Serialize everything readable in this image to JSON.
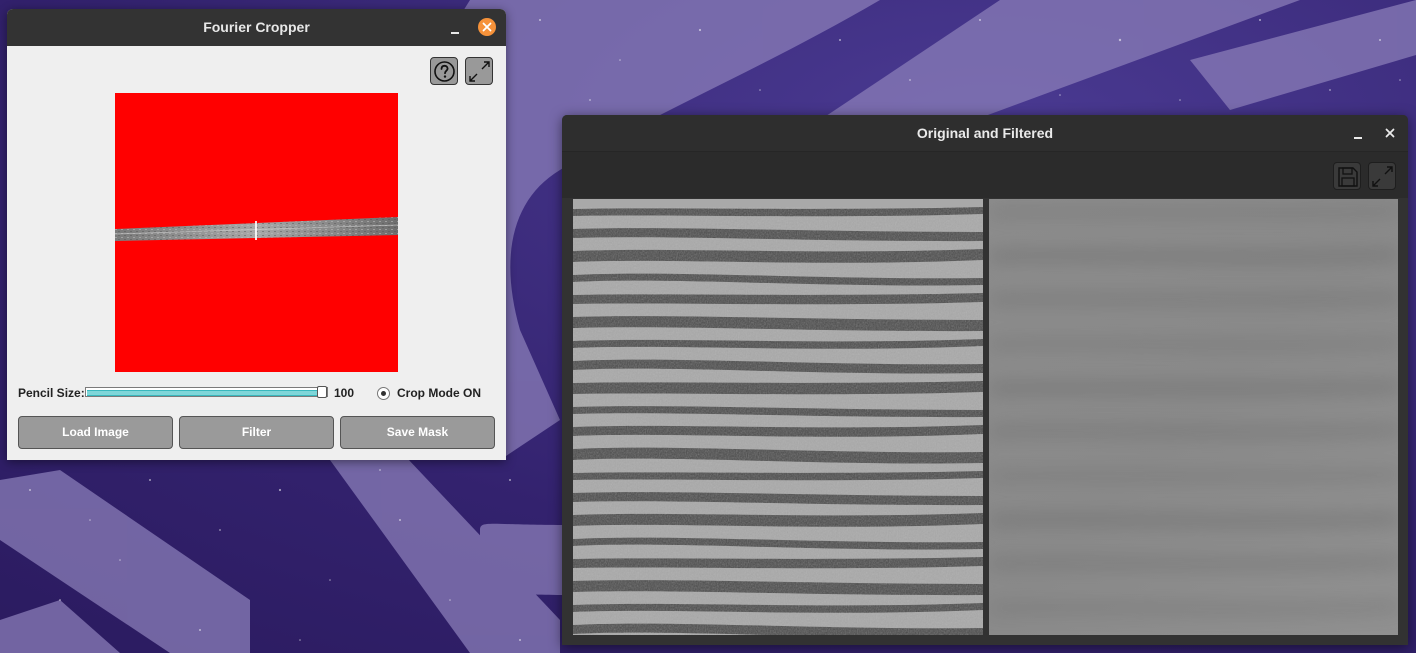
{
  "cropper_window": {
    "title": "Fourier Cropper",
    "help_icon": "question-circle-icon",
    "expand_icon": "expand-arrows-icon",
    "pencil_label": "Pencil Size:",
    "pencil_value": "100",
    "pencil_min": 0,
    "pencil_max": 100,
    "pencil_level": 100,
    "crop_mode_label": "Crop Mode ON",
    "crop_mode_checked": true,
    "buttons": {
      "load": "Load Image",
      "filter": "Filter",
      "save_mask": "Save Mask"
    },
    "colors": {
      "mask": "#ff0000",
      "close": "#f6923a",
      "slider_fill": "#7fd6d9"
    }
  },
  "filtered_window": {
    "title": "Original and Filtered",
    "save_icon": "floppy-disk-icon",
    "expand_icon": "expand-arrows-icon"
  }
}
